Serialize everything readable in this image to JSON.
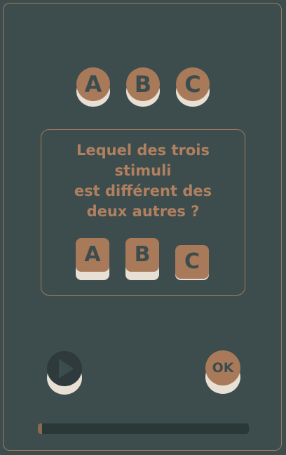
{
  "stimuli": [
    {
      "label": "A"
    },
    {
      "label": "B"
    },
    {
      "label": "C"
    }
  ],
  "question": {
    "lines": [
      "Lequel des trois",
      "stimuli",
      "est différent des",
      "deux autres ?"
    ]
  },
  "answers": [
    {
      "label": "A",
      "pressed": false
    },
    {
      "label": "B",
      "pressed": false
    },
    {
      "label": "C",
      "pressed": true
    }
  ],
  "controls": {
    "play_icon": "play-icon",
    "ok_label": "OK"
  },
  "progress": {
    "fraction": 0.02
  },
  "colors": {
    "background": "#3d4d4d",
    "accent": "#a87a5a",
    "text": "#b08060",
    "button_shadow": "#e8e0d4"
  }
}
